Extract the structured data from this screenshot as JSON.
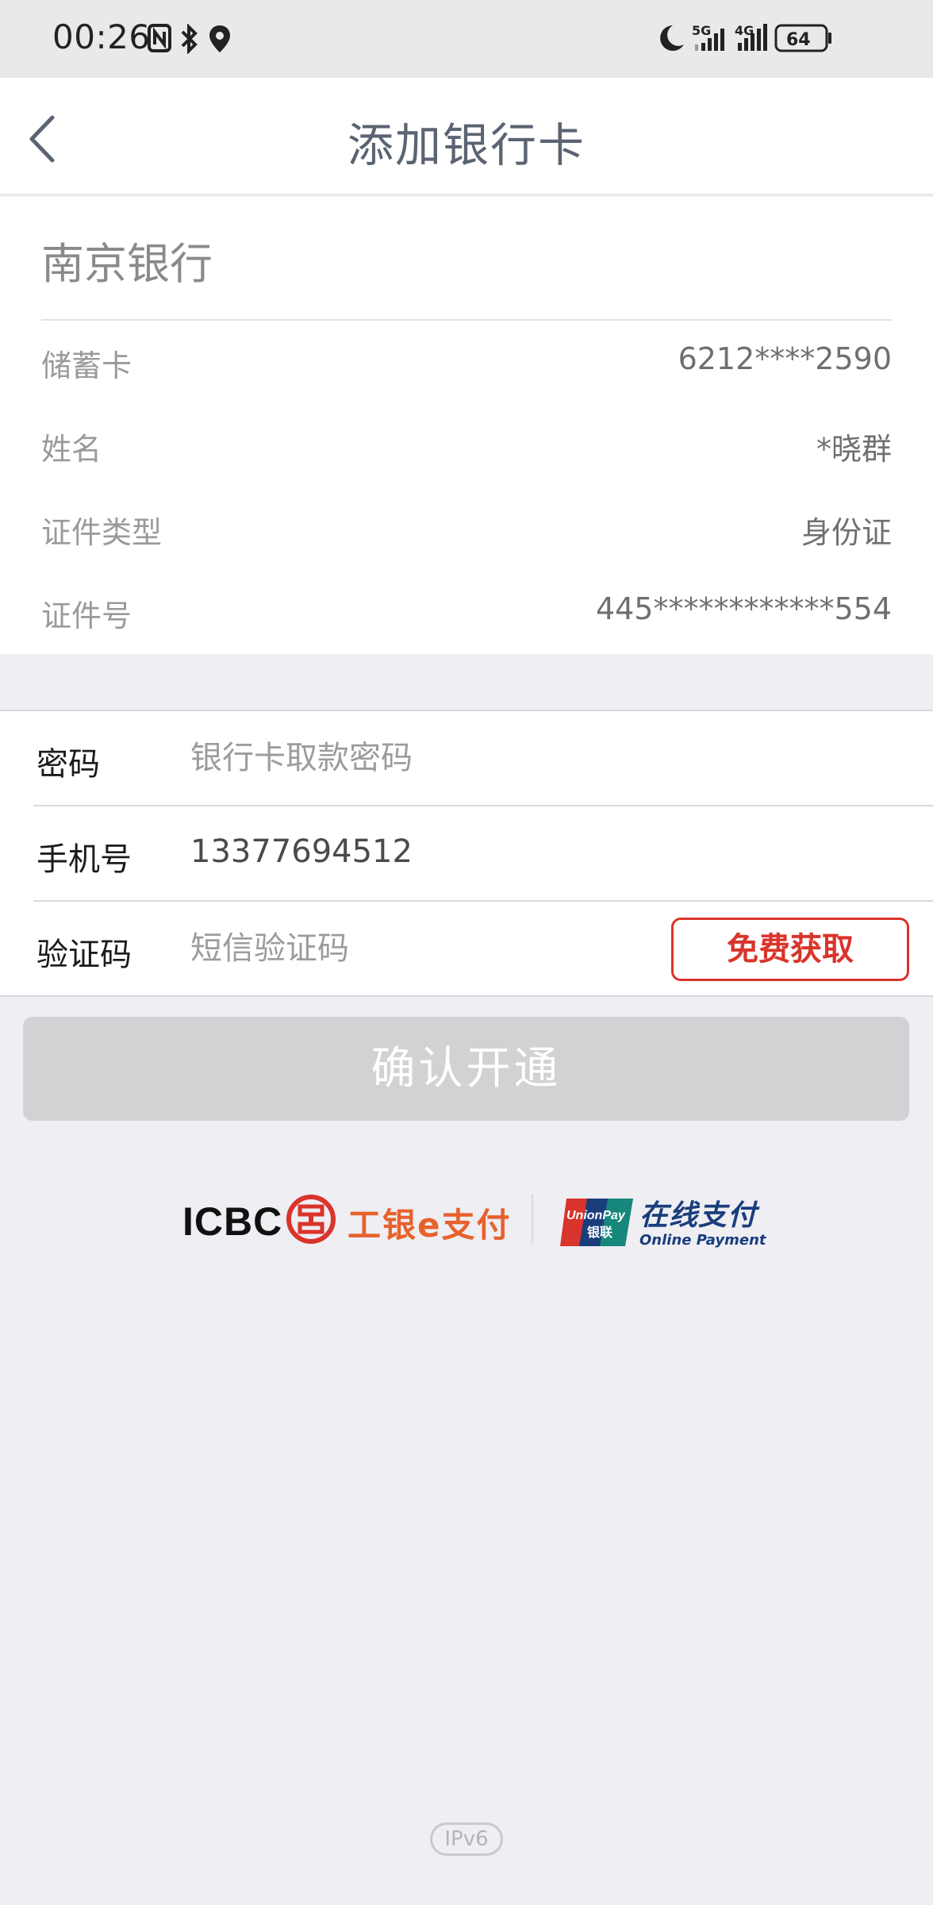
{
  "status_bar": {
    "time": "00:26",
    "icons": [
      "nfc-icon",
      "bluetooth-icon",
      "location-icon",
      "moon-icon",
      "5g-signal-icon",
      "4g-signal-icon",
      "battery-icon"
    ],
    "network_5g": "5G",
    "network_4g": "4G",
    "battery": "64"
  },
  "nav": {
    "title": "添加银行卡",
    "back_icon": "chevron-left-icon"
  },
  "bank": {
    "name": "南京银行",
    "rows": [
      {
        "label": "储蓄卡",
        "value": "6212****2590"
      },
      {
        "label": "姓名",
        "value": "*晓群"
      },
      {
        "label": "证件类型",
        "value": "身份证"
      },
      {
        "label": "证件号",
        "value": "445************554"
      }
    ]
  },
  "form": {
    "password": {
      "label": "密码",
      "placeholder": "银行卡取款密码"
    },
    "phone": {
      "label": "手机号",
      "value": "13377694512"
    },
    "sms": {
      "label": "验证码",
      "placeholder": "短信验证码",
      "button": "免费获取"
    }
  },
  "confirm_button": "确认开通",
  "logos": {
    "icbc": "ICBC",
    "icbc_pay": "工银e支付",
    "unionpay_cn": "银联",
    "unionpay_en": "UnionPay",
    "online_pay_cn": "在线支付",
    "online_pay_en": "Online Payment"
  },
  "footer": {
    "ipv6": "IPv6"
  },
  "colors": {
    "accent_red": "#d9342b",
    "disabled_button": "#d2d2d4",
    "page_bg": "#eeeef3"
  }
}
